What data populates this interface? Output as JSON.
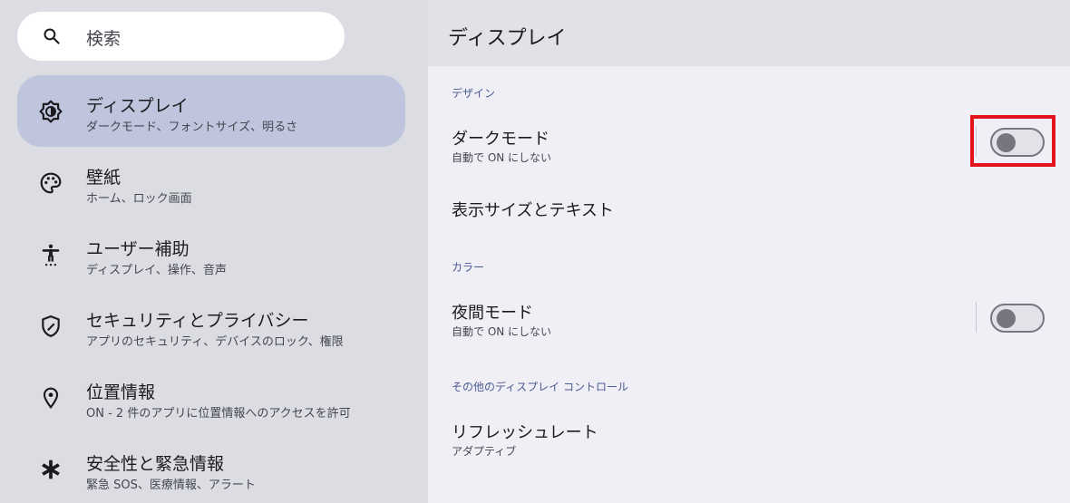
{
  "search": {
    "placeholder": "検索"
  },
  "nav": {
    "items": [
      {
        "title": "ディスプレイ",
        "sub": "ダークモード、フォントサイズ、明るさ",
        "active": true,
        "icon": "brightness-icon"
      },
      {
        "title": "壁紙",
        "sub": "ホーム、ロック画面",
        "icon": "palette-icon"
      },
      {
        "title": "ユーザー補助",
        "sub": "ディスプレイ、操作、音声",
        "icon": "accessibility-icon"
      },
      {
        "title": "セキュリティとプライバシー",
        "sub": "アプリのセキュリティ、デバイスのロック、権限",
        "icon": "shield-icon"
      },
      {
        "title": "位置情報",
        "sub": "ON - 2 件のアプリに位置情報へのアクセスを許可",
        "icon": "location-pin-icon"
      },
      {
        "title": "安全性と緊急情報",
        "sub": "緊急 SOS、医療情報、アラート",
        "icon": "asterisk-icon"
      }
    ]
  },
  "header": {
    "title": "ディスプレイ"
  },
  "sections": {
    "design": {
      "label": "デザイン",
      "dark_mode": {
        "title": "ダークモード",
        "sub": "自動で ON にしない",
        "toggle_on": false
      },
      "display_size": {
        "title": "表示サイズとテキスト"
      }
    },
    "color": {
      "label": "カラー",
      "night_mode": {
        "title": "夜間モード",
        "sub": "自動で ON にしない",
        "toggle_on": false
      }
    },
    "other": {
      "label": "その他のディスプレイ コントロール",
      "refresh": {
        "title": "リフレッシュレート",
        "sub": "アダプティブ"
      }
    }
  },
  "colors": {
    "accent": "#4a5a92",
    "active_nav": "#bfc5dc",
    "highlight_box": "#e3131e"
  }
}
